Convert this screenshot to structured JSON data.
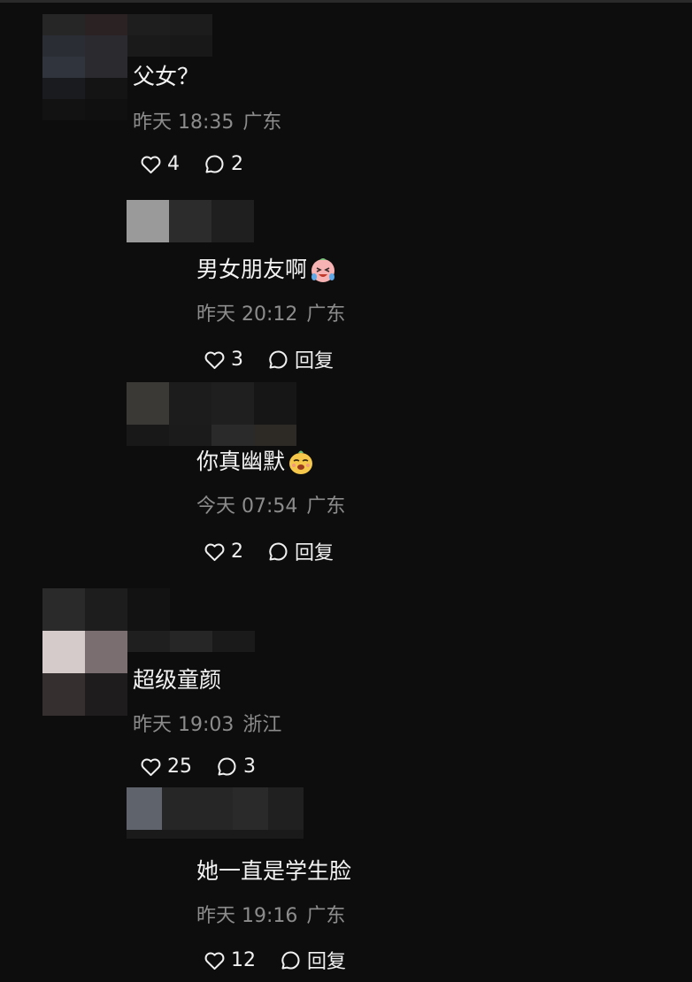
{
  "comments": [
    {
      "text": "父女？",
      "time": "昨天 18:35",
      "location": "广东",
      "likes": "4",
      "replies": "2",
      "emoji": ""
    },
    {
      "text": "男女朋友啊",
      "time": "昨天 20:12",
      "location": "广东",
      "likes": "3",
      "reply_label": "回复",
      "emoji": "crying-laughing-face-icon"
    },
    {
      "text": "你真幽默",
      "time": "今天 07:54",
      "location": "广东",
      "likes": "2",
      "reply_label": "回复",
      "emoji": "smirk-face-icon"
    },
    {
      "text": "超级童颜",
      "time": "昨天 19:03",
      "location": "浙江",
      "likes": "25",
      "replies": "3",
      "emoji": ""
    },
    {
      "text": "她一直是学生脸",
      "time": "昨天 19:16",
      "location": "广东",
      "likes": "12",
      "reply_label": "回复",
      "emoji": ""
    }
  ],
  "colors": {
    "background": "#0d0d0d",
    "text": "#f2f2f2",
    "meta": "#8c8c8c"
  }
}
